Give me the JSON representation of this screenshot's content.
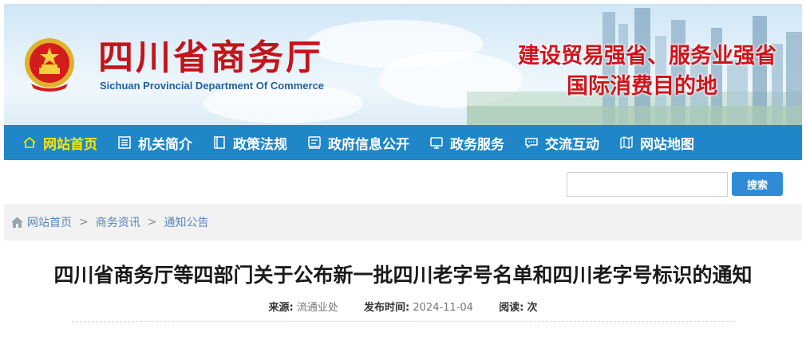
{
  "header": {
    "brand_cn": "四川省商务厅",
    "brand_en": "Sichuan Provincial Department Of Commerce",
    "slogan_line1": "建设贸易强省、服务业强省",
    "slogan_line2": "国际消费目的地",
    "emblem_icon": "national-emblem-icon",
    "brand_color": "#c4141a"
  },
  "nav": {
    "items": [
      {
        "label": "网站首页",
        "icon": "home-icon",
        "active": true
      },
      {
        "label": "机关简介",
        "icon": "list-icon",
        "active": false
      },
      {
        "label": "政策法规",
        "icon": "book-icon",
        "active": false
      },
      {
        "label": "政府信息公开",
        "icon": "info-board-icon",
        "active": false
      },
      {
        "label": "政务服务",
        "icon": "monitor-icon",
        "active": false
      },
      {
        "label": "交流互动",
        "icon": "chat-icon",
        "active": false
      },
      {
        "label": "网站地图",
        "icon": "map-icon",
        "active": false
      }
    ],
    "bg_color": "#1f86c7",
    "active_color": "#ffe600"
  },
  "search": {
    "value": "",
    "placeholder": "",
    "button_label": "搜索"
  },
  "breadcrumb": {
    "items": [
      "网站首页",
      "商务资讯",
      "通知公告"
    ],
    "separator": ">"
  },
  "article": {
    "title": "四川省商务厅等四部门关于公布新一批四川老字号名单和四川老字号标识的通知",
    "source_label": "来源:",
    "source_value": "流通业处",
    "date_label": "发布时间:",
    "date_value": "2024-11-04",
    "views_label": "阅读:",
    "views_value": "次"
  }
}
